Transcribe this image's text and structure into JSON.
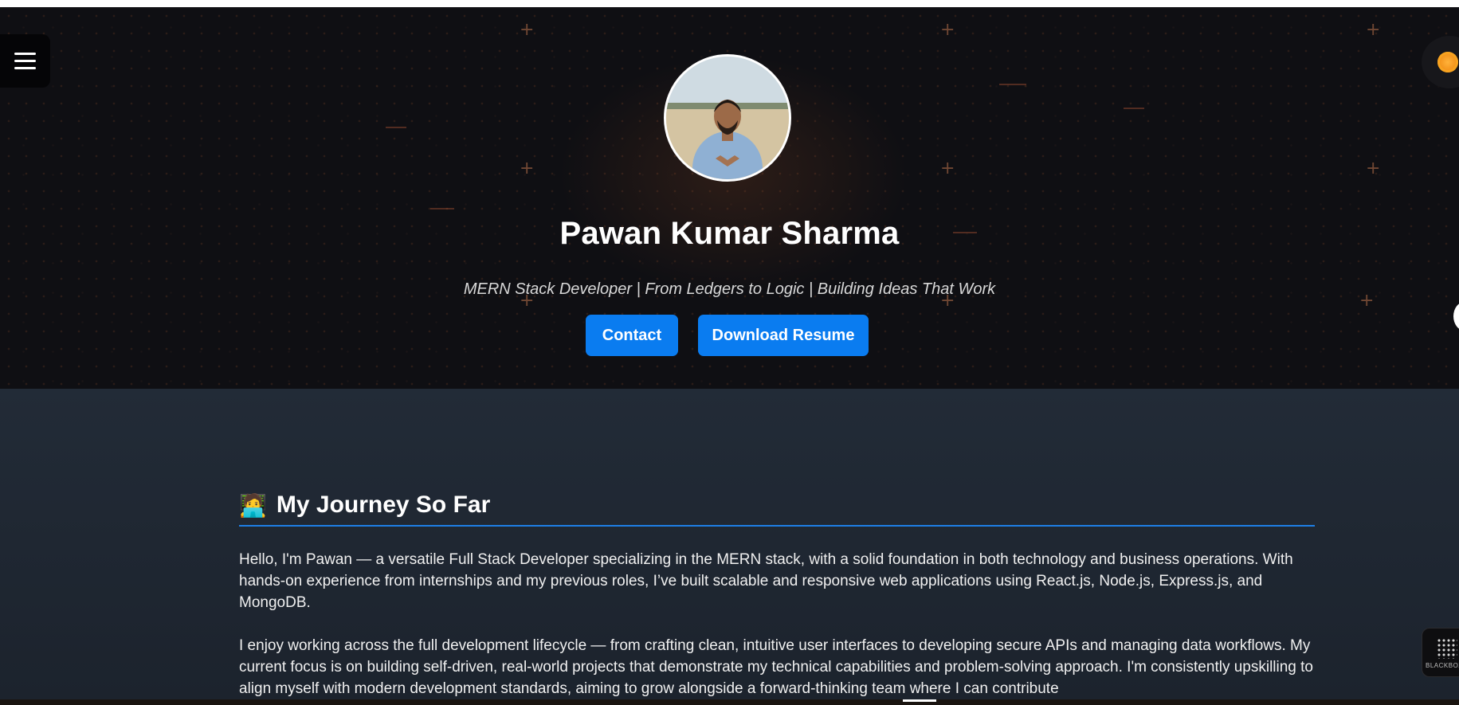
{
  "header": {
    "menu_icon": "hamburger-icon",
    "theme_icon": "sun-icon"
  },
  "profile": {
    "name": "Pawan Kumar Sharma",
    "tagline": "MERN Stack Developer | From Ledgers to Logic | Building Ideas That Work"
  },
  "actions": {
    "contact_label": "Contact",
    "resume_label": "Download Resume"
  },
  "about": {
    "emoji": "🧑‍💻",
    "title": "My Journey So Far",
    "paragraph_1": "Hello, I'm Pawan — a versatile Full Stack Developer specializing in the MERN stack, with a solid foundation in both technology and business operations. With hands-on experience from internships and my previous roles, I’ve built scalable and responsive web applications using React.js, Node.js, Express.js, and MongoDB.",
    "paragraph_2": "I enjoy working across the full development lifecycle — from crafting clean, intuitive user interfaces to developing secure APIs and managing data workflows. My current focus is on building self-driven, real-world projects that demonstrate my technical capabilities and problem-solving approach. I'm consistently upskilling to align myself with modern development standards, aiming to grow alongside a forward-thinking team where I can contribute"
  },
  "widget": {
    "label": "BLACKBOX"
  },
  "colors": {
    "hero_bg": "#0f0f13",
    "about_bg": "#222b37",
    "accent": "#0a7cf0",
    "rule": "#1e7fe6"
  }
}
